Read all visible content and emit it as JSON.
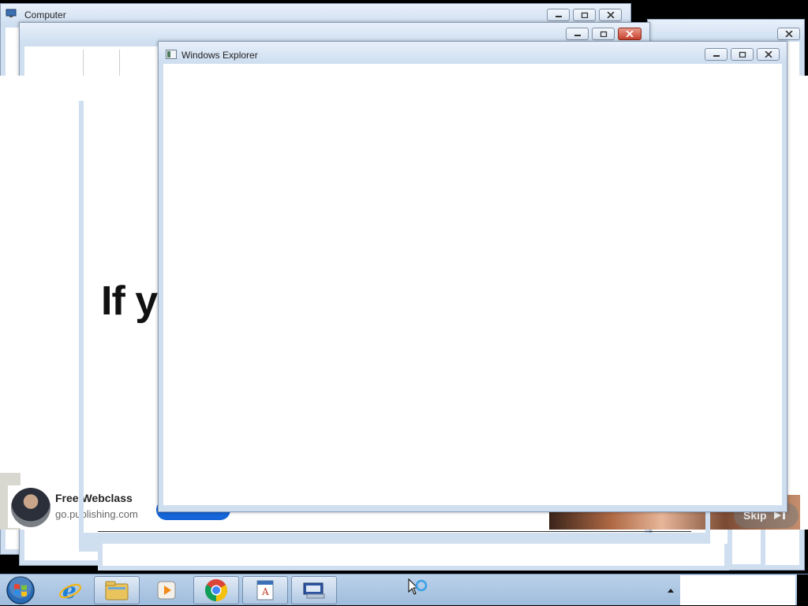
{
  "windows": {
    "computer": {
      "title": "Computer"
    },
    "explorer": {
      "title": "Windows Explorer"
    }
  },
  "background_page": {
    "headline": "If y",
    "ad": {
      "title": "Free Webclass",
      "url": "go.publishing.com",
      "skip_label": "Skip"
    }
  },
  "taskbar": {
    "items": [
      "start-orb",
      "internet-explorer",
      "file-explorer",
      "media-player",
      "chrome",
      "wordpad",
      "on-screen-keyboard"
    ]
  },
  "colors": {
    "taskbar": "#a9c3e2",
    "titlebar": "#dbe7f5",
    "close_red": "#c8402d",
    "ad_button_blue": "#1565d8"
  }
}
